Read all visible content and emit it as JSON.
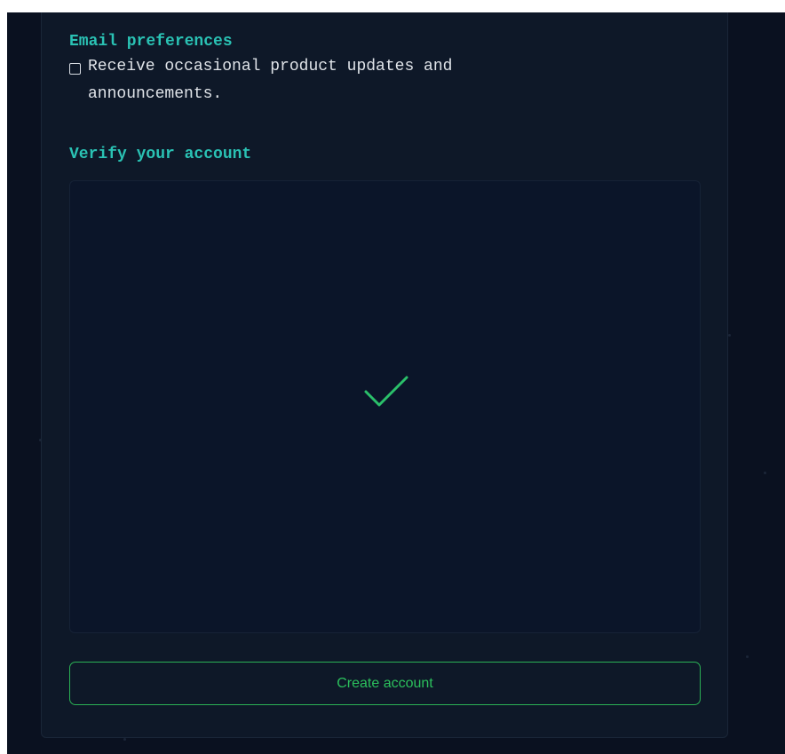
{
  "colors": {
    "page_background": "#0a1120",
    "panel_background": "#0e1828",
    "heading_accent": "#2ac2b4",
    "success_green": "#2bc05c",
    "body_text": "#dfe3e8"
  },
  "email_preferences": {
    "heading": "Email preferences",
    "checkbox": {
      "checked": false,
      "label": "Receive occasional product updates and announcements."
    }
  },
  "verification": {
    "heading": "Verify your account",
    "status_icon": "checkmark-icon",
    "verified": true
  },
  "actions": {
    "create_account_label": "Create account"
  }
}
